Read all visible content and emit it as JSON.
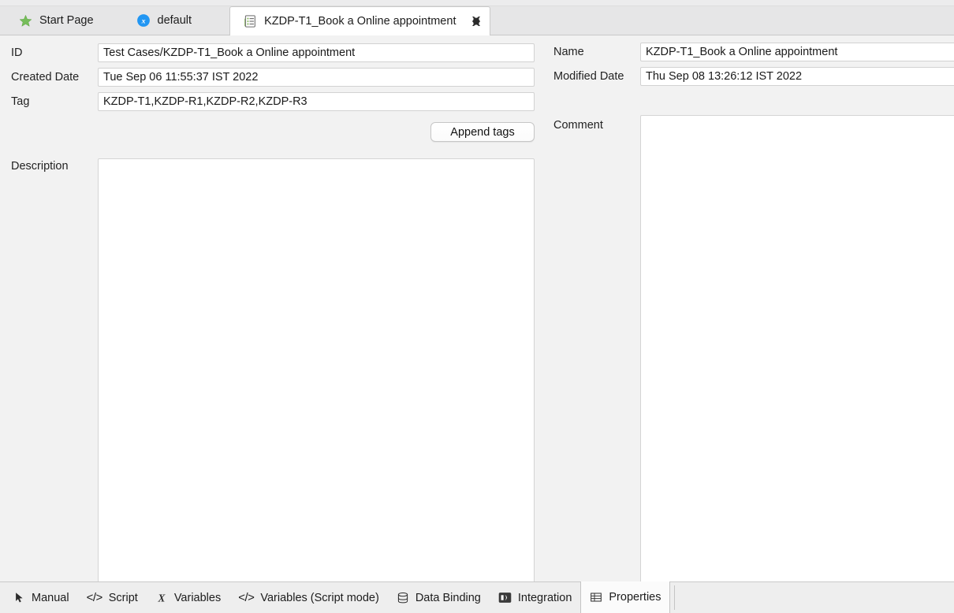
{
  "window": {
    "editor_tabs": [
      {
        "label": "Start Page",
        "icon": "star-icon",
        "active": false
      },
      {
        "label": "default",
        "icon": "blue-x-circle-icon",
        "active": false
      },
      {
        "label": "KZDP-T1_Book a Online appointment",
        "icon": "test-case-icon",
        "active": true,
        "close_icon": "close-icon"
      }
    ]
  },
  "properties": {
    "id": {
      "label": "ID",
      "value": "Test Cases/KZDP-T1_Book a Online appointment"
    },
    "created_date": {
      "label": "Created Date",
      "value": "Tue Sep 06 11:55:37 IST 2022"
    },
    "tag": {
      "label": "Tag",
      "value": "KZDP-T1,KZDP-R1,KZDP-R2,KZDP-R3"
    },
    "append_tags": {
      "label": "Append tags"
    },
    "description": {
      "label": "Description",
      "value": "",
      "placeholder": ""
    },
    "name": {
      "label": "Name",
      "value": "KZDP-T1_Book a Online appointment"
    },
    "modified_date": {
      "label": "Modified Date",
      "value": "Thu Sep 08 13:26:12 IST 2022"
    },
    "comment": {
      "label": "Comment",
      "value": "",
      "placeholder": ""
    }
  },
  "bottom_tabs": [
    {
      "label": "Manual",
      "icon": "cursor-arrow-icon",
      "active": false
    },
    {
      "label": "Script",
      "icon": "code-icon",
      "active": false
    },
    {
      "label": "Variables",
      "icon": "variable-x-icon",
      "active": false
    },
    {
      "label": "Variables (Script mode)",
      "icon": "code-icon",
      "active": false
    },
    {
      "label": "Data Binding",
      "icon": "database-icon",
      "active": false
    },
    {
      "label": "Integration",
      "icon": "integration-icon",
      "active": false
    },
    {
      "label": "Properties",
      "icon": "table-grid-icon",
      "active": true
    }
  ],
  "colors": {
    "tabbar_bg": "#e6e6e7",
    "content_bg": "#f2f2f2",
    "active_tab_bg": "#ffffff",
    "field_bg": "#ffffff",
    "accent_green": "#6ebe4a",
    "accent_blue": "#2196f3"
  }
}
